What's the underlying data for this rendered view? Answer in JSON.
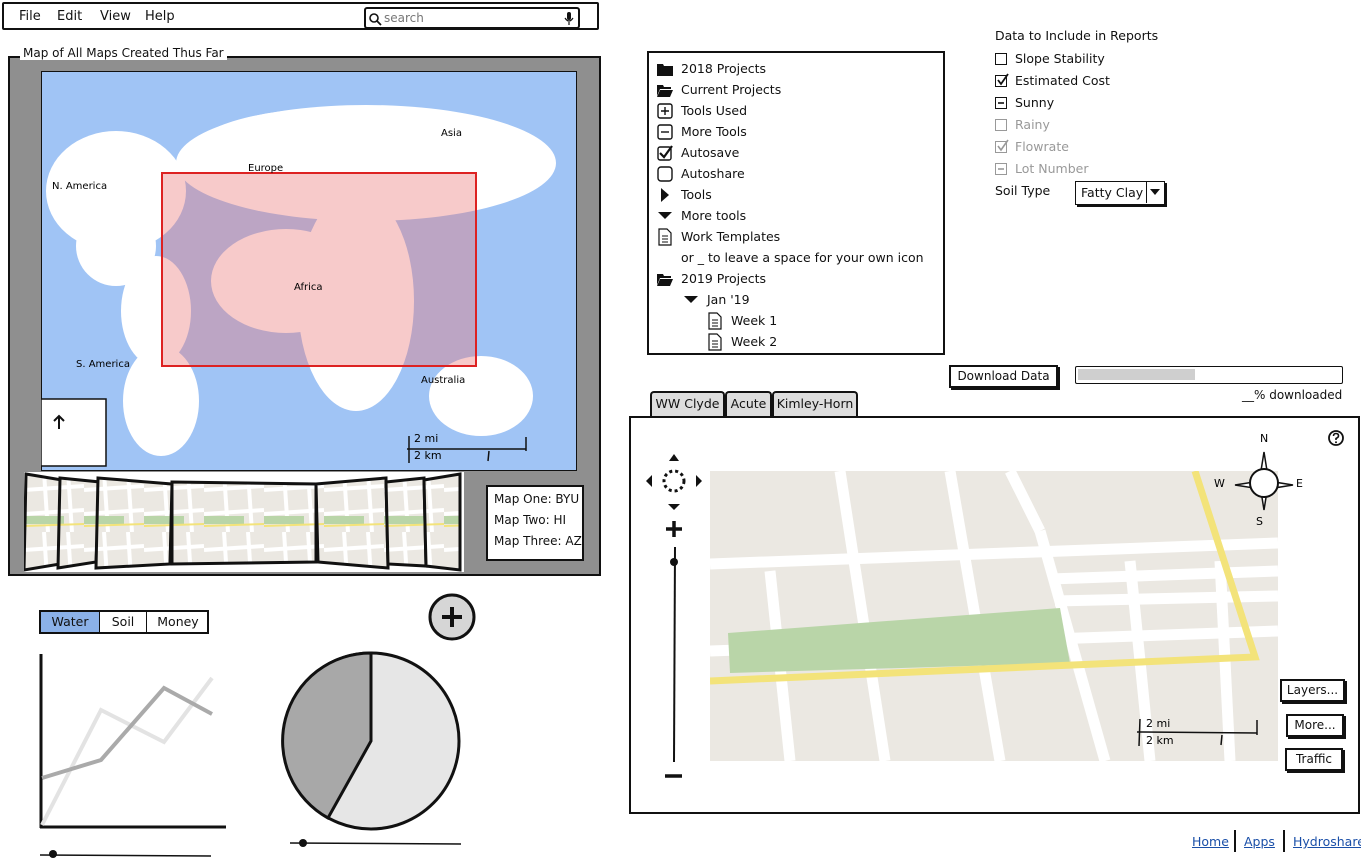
{
  "menu": {
    "items": [
      "File",
      "Edit",
      "View",
      "Help"
    ]
  },
  "search": {
    "placeholder": "search"
  },
  "maps_panel": {
    "title": "Map of All Maps Created Thus Far",
    "regions": {
      "asia": "Asia",
      "europe": "Europe",
      "n_america": "N. America",
      "africa": "Africa",
      "s_america": "S. America",
      "australia": "Australia"
    },
    "scale": {
      "mi": "2 mi",
      "km": "2 km"
    },
    "legend": [
      "Map One: BYU",
      "Map Two: HI",
      "Map Three: AZ"
    ]
  },
  "tree": {
    "items": [
      {
        "label": "2018 Projects",
        "icon": "folder-closed-icon"
      },
      {
        "label": "Current Projects",
        "icon": "folder-open-icon"
      },
      {
        "label": "Tools Used",
        "icon": "plus-square-icon"
      },
      {
        "label": "More Tools",
        "icon": "minus-square-icon"
      },
      {
        "label": "Autosave",
        "icon": "checkbox-checked-icon"
      },
      {
        "label": "Autoshare",
        "icon": "checkbox-empty-icon"
      },
      {
        "label": "Tools",
        "icon": "triangle-right-icon"
      },
      {
        "label": "More tools",
        "icon": "triangle-down-icon"
      },
      {
        "label": "Work Templates",
        "icon": "document-icon"
      },
      {
        "label": "or _ to leave a space for your own icon",
        "icon": ""
      },
      {
        "label": "2019 Projects",
        "icon": "folder-open-icon"
      },
      {
        "label": "Jan '19",
        "icon": "triangle-down-icon"
      },
      {
        "label": "Week 1",
        "icon": "document-icon"
      },
      {
        "label": "Week 2",
        "icon": "document-icon"
      }
    ]
  },
  "report": {
    "title": "Data to Include in Reports",
    "options": [
      {
        "label": "Slope Stability",
        "state": "unchecked",
        "enabled": true
      },
      {
        "label": "Estimated Cost",
        "state": "checked",
        "enabled": true
      },
      {
        "label": "Sunny",
        "state": "indeterminate",
        "enabled": true
      },
      {
        "label": "Rainy",
        "state": "unchecked",
        "enabled": false
      },
      {
        "label": "Flowrate",
        "state": "checked",
        "enabled": false
      },
      {
        "label": "Lot Number",
        "state": "indeterminate",
        "enabled": false
      }
    ],
    "soil_label": "Soil Type",
    "soil_value": "Fatty Clay"
  },
  "download": {
    "button": "Download Data",
    "progress": 0.45,
    "caption": "__% downloaded"
  },
  "tabs": [
    "WW Clyde",
    "Acute",
    "Kimley-Horn"
  ],
  "map_widget": {
    "compass": {
      "n": "N",
      "e": "E",
      "s": "S",
      "w": "W"
    },
    "scale": {
      "mi": "2 mi",
      "km": "2 km"
    },
    "buttons": [
      "Layers...",
      "More...",
      "Traffic"
    ]
  },
  "segmented": [
    "Water",
    "Soil",
    "Money"
  ],
  "footer": [
    "Home",
    "Apps",
    "Hydroshare"
  ]
}
